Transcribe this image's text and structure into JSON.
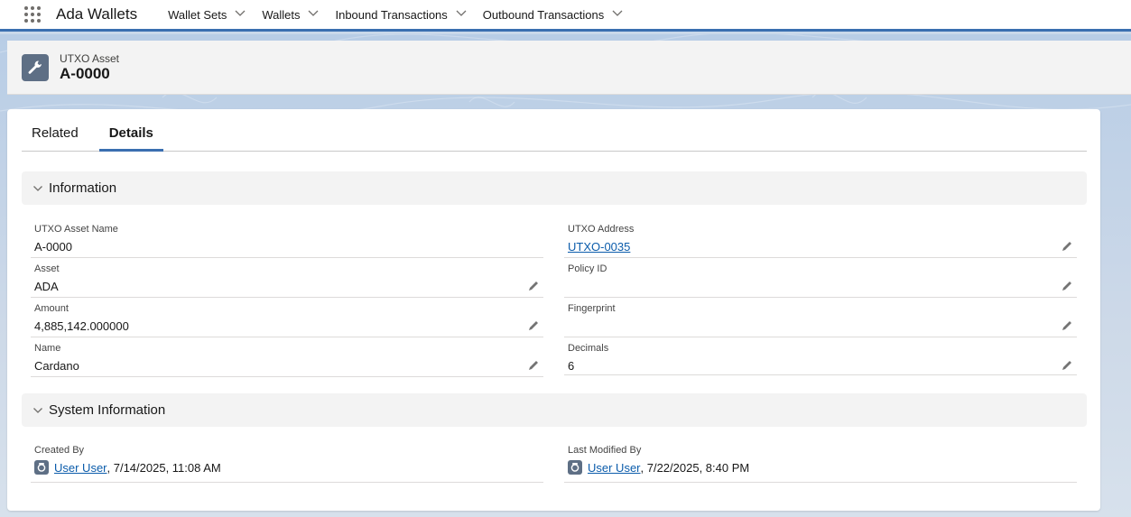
{
  "app": {
    "name": "Ada Wallets"
  },
  "nav": [
    {
      "label": "Wallet Sets"
    },
    {
      "label": "Wallets"
    },
    {
      "label": "Inbound Transactions"
    },
    {
      "label": "Outbound Transactions"
    }
  ],
  "record": {
    "type": "UTXO Asset",
    "title": "A-0000"
  },
  "tabs": [
    {
      "label": "Related",
      "active": false
    },
    {
      "label": "Details",
      "active": true
    }
  ],
  "sections": {
    "information": {
      "title": "Information"
    },
    "system": {
      "title": "System Information"
    }
  },
  "fields": {
    "utxo_asset_name": {
      "label": "UTXO Asset Name",
      "value": "A-0000"
    },
    "asset": {
      "label": "Asset",
      "value": "ADA"
    },
    "amount": {
      "label": "Amount",
      "value": "4,885,142.000000"
    },
    "name": {
      "label": "Name",
      "value": "Cardano"
    },
    "utxo_address": {
      "label": "UTXO Address",
      "value": "UTXO-0035"
    },
    "policy_id": {
      "label": "Policy ID",
      "value": ""
    },
    "fingerprint": {
      "label": "Fingerprint",
      "value": ""
    },
    "decimals": {
      "label": "Decimals",
      "value": "6"
    }
  },
  "system": {
    "created_by": {
      "label": "Created By",
      "user": "User User",
      "date": ", 7/14/2025, 11:08 AM"
    },
    "last_modified_by": {
      "label": "Last Modified By",
      "user": "User User",
      "date": ", 7/22/2025, 8:40 PM"
    }
  },
  "colors": {
    "accent": "#3a6fb0",
    "link": "#0b5cab",
    "icon_bg": "#5e6f85"
  }
}
